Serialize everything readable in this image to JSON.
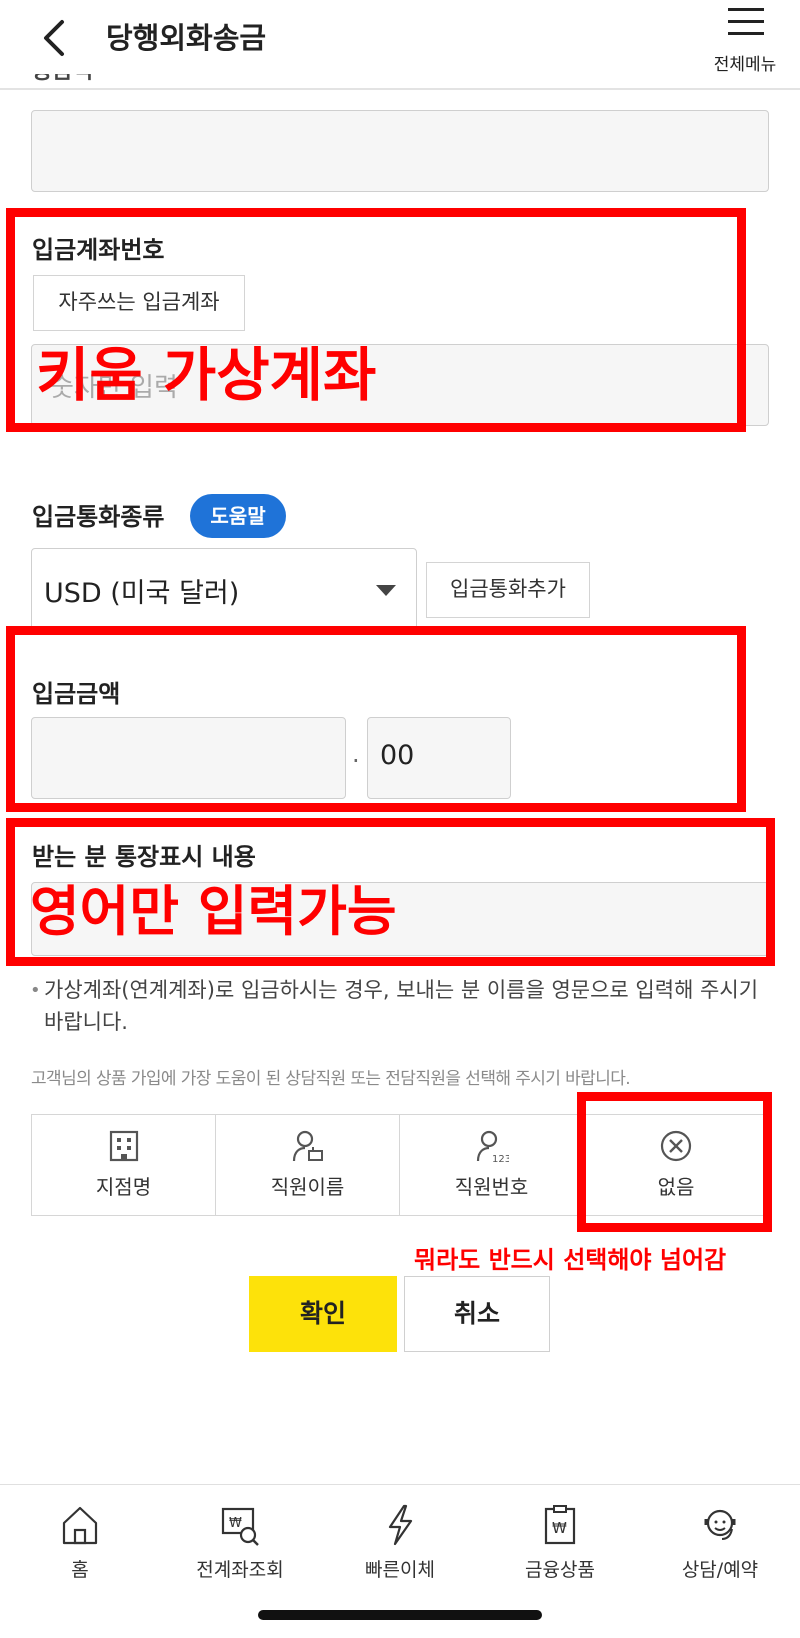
{
  "header": {
    "title": "당행외화송금",
    "menu_label": "전체메뉴"
  },
  "top_cut_label": "송금액",
  "deposit_account": {
    "label": "입금계좌번호",
    "frequent_button": "자주쓰는 입금계좌",
    "placeholder": "숫자만 입력"
  },
  "currency": {
    "label": "입금통화종류",
    "help_badge": "도움말",
    "selected": "USD (미국 달러)",
    "add_button": "입금통화추가"
  },
  "amount": {
    "label": "입금금액",
    "separator": ".",
    "decimal_value": "00"
  },
  "passbook_memo": {
    "label": "받는 분 통장표시 내용"
  },
  "notes": {
    "virtual_account": "가상계좌(연계계좌)로 입금하시는 경우, 보내는 분 이름을 영문으로 입력해 주시기 바랍니다.",
    "staff_select": "고객님의 상품 가입에 가장 도움이 된 상담직원 또는 전담직원을 선택해 주시기 바랍니다."
  },
  "staff_options": [
    {
      "label": "지점명",
      "icon": "building-icon"
    },
    {
      "label": "직원이름",
      "icon": "person-name-icon"
    },
    {
      "label": "직원번호",
      "icon": "person-123-icon"
    },
    {
      "label": "없음",
      "icon": "circle-x-icon"
    }
  ],
  "buttons": {
    "confirm": "확인",
    "cancel": "취소"
  },
  "annotations": {
    "account": "키움 가상계좌",
    "english_only": "영어만 입력가능",
    "must_select": "뭐라도 반드시 선택해야 넘어감",
    "color": "#ff0000"
  },
  "bottom_nav": [
    {
      "label": "홈",
      "icon": "home-icon"
    },
    {
      "label": "전계좌조회",
      "icon": "account-search-icon"
    },
    {
      "label": "빠른이체",
      "icon": "lightning-icon"
    },
    {
      "label": "금융상품",
      "icon": "product-icon"
    },
    {
      "label": "상담/예약",
      "icon": "headset-icon"
    }
  ],
  "colors": {
    "confirm": "#fde20a",
    "help_badge": "#1f73d8"
  }
}
